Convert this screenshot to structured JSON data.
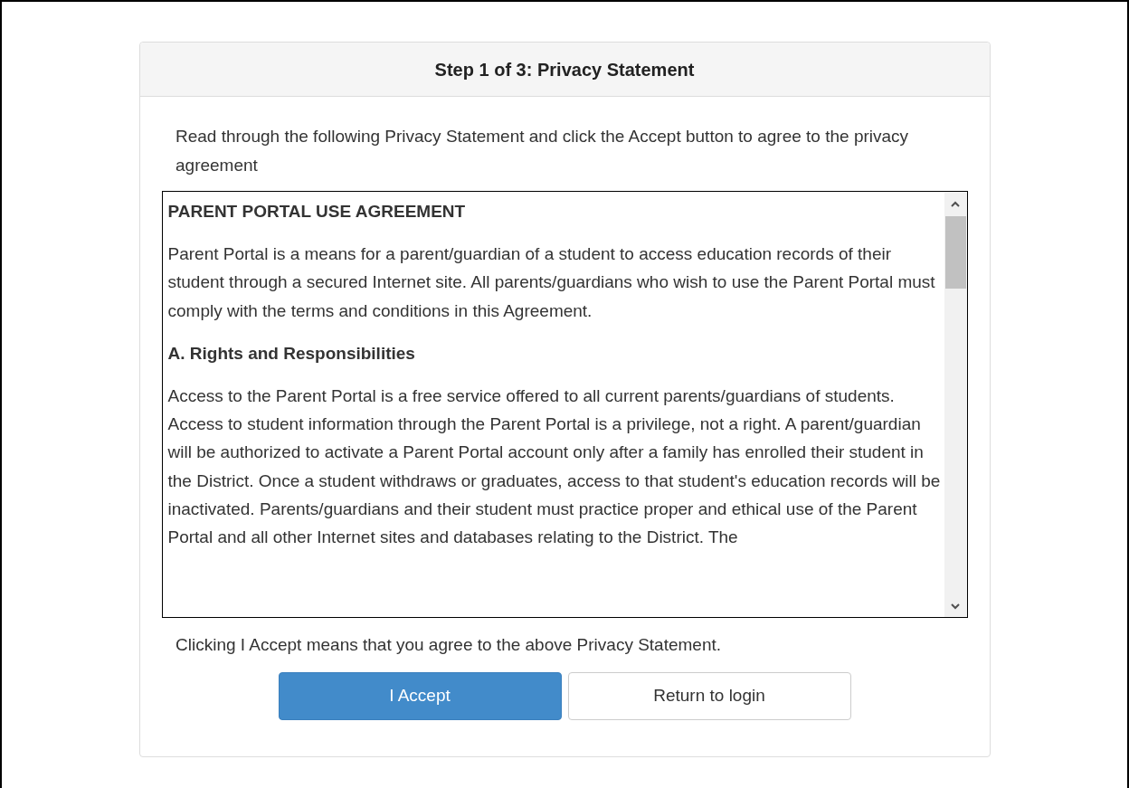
{
  "dialog": {
    "title": "Step 1 of 3: Privacy Statement",
    "intro": "Read through the following Privacy Statement and click the Accept button to agree to the privacy agreement",
    "agreement": [
      {
        "kind": "heading",
        "text": "PARENT PORTAL USE AGREEMENT"
      },
      {
        "kind": "paragraph",
        "text": "Parent Portal is a means for a parent/guardian of a student to access education records of their student through a secured Internet site. All parents/guardians who wish to use the Parent Portal must comply with the terms and conditions in this Agreement."
      },
      {
        "kind": "heading",
        "text": "A. Rights and Responsibilities"
      },
      {
        "kind": "paragraph",
        "text": "Access to the Parent Portal is a free service offered to all current parents/guardians of students. Access to student information through the Parent Portal is a privilege, not a right. A parent/guardian will be authorized to activate a Parent Portal account only after a family has enrolled their student in the District. Once a student withdraws or graduates, access to that student's education records will be inactivated. Parents/guardians and their student must practice proper and ethical use of the Parent Portal and all other Internet sites and databases relating to the District. The"
      }
    ],
    "note": "Clicking I Accept means that you agree to the above Privacy Statement.",
    "buttons": [
      {
        "kind": "primary",
        "label": "I Accept"
      },
      {
        "kind": "default",
        "label": "Return to login"
      }
    ]
  }
}
